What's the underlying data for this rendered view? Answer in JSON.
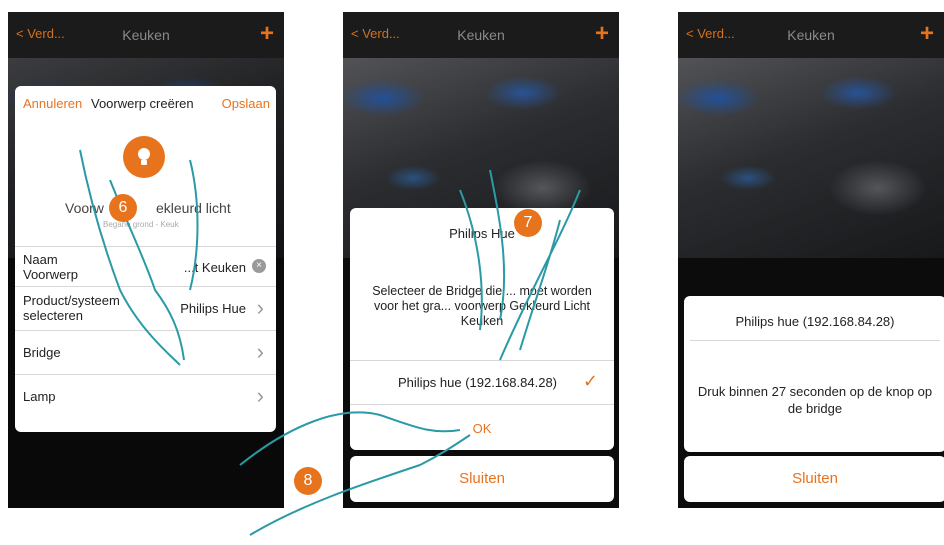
{
  "screens": [
    {
      "nav": {
        "back": "< Verd...",
        "title": "Keuken",
        "plus": "+"
      },
      "dialog": {
        "cancel": "Annuleren",
        "title": "Voorwerp creëren",
        "save": "Opslaan",
        "object_name_partial_left": "Voorw",
        "object_name_partial_right": "ekleurd licht",
        "object_subtitle": "Begane grond - Keuk",
        "rows": [
          {
            "label": "Naam Voorwerp",
            "value": "...t Keuken"
          },
          {
            "label": "Product/systeem selecteren",
            "value": "Philips Hue"
          },
          {
            "label": "Bridge",
            "value": ""
          },
          {
            "label": "Lamp",
            "value": ""
          }
        ]
      },
      "step": "6"
    },
    {
      "nav": {
        "back": "< Verd...",
        "title": "Keuken",
        "plus": "+"
      },
      "dialog": {
        "title": "Philips Hue",
        "message": "Selecteer de Bridge die ... moet worden voor het gra... voorwerp Gekleurd Licht Keuken",
        "option": "Philips hue (192.168.84.28)",
        "ok": "OK",
        "close": "Sluiten"
      },
      "step7": "7",
      "step8": "8"
    },
    {
      "nav": {
        "back": "< Verd...",
        "title": "Keuken",
        "plus": "+"
      },
      "dialog": {
        "bridge": "Philips hue (192.168.84.28)",
        "message": "Druk binnen 27 seconden op de knop op de bridge",
        "close": "Sluiten"
      }
    }
  ],
  "colors": {
    "accent": "#e8731d",
    "navbar": "#1b1b1b",
    "hand_outline": "#2a9aa6"
  }
}
